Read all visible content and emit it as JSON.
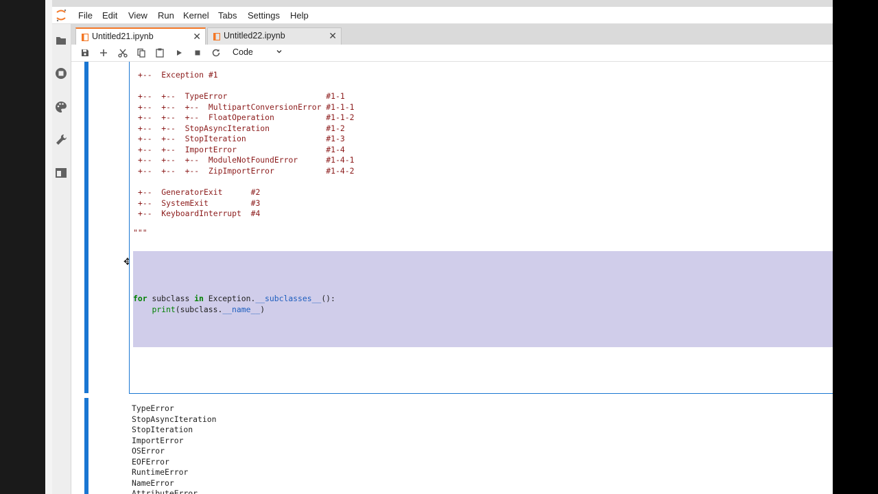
{
  "menu": [
    "File",
    "Edit",
    "View",
    "Run",
    "Kernel",
    "Tabs",
    "Settings",
    "Help"
  ],
  "tabs": [
    {
      "label": "Untitled21.ipynb",
      "active": true
    },
    {
      "label": "Untitled22.ipynb",
      "active": false
    }
  ],
  "toolbar": {
    "cell_type": "Code",
    "buttons": [
      "save-icon",
      "add-cell-icon",
      "cut-icon",
      "copy-icon",
      "paste-icon",
      "run-icon",
      "stop-icon",
      "restart-icon"
    ]
  },
  "sidebar_icons": [
    "folder-icon",
    "running-icon",
    "palette-icon",
    "wrench-icon",
    "tabs-icon"
  ],
  "code": {
    "tree_header": "+--  Exception #1",
    "tree_block1": [
      "+--  +--  TypeError                     #1-1",
      "+--  +--  +--  MultipartConversionError #1-1-1",
      "+--  +--  +--  FloatOperation           #1-1-2",
      "+--  +--  StopAsyncIteration            #1-2",
      "+--  +--  StopIteration                 #1-3",
      "+--  +--  ImportError                   #1-4",
      "+--  +--  +--  ModuleNotFoundError      #1-4-1",
      "+--  +--  +--  ZipImportError           #1-4-2"
    ],
    "tree_block2": [
      "+--  GeneratorExit      #2",
      "+--  SystemExit         #3",
      "+--  KeyboardInterrupt  #4"
    ],
    "docstring_end": "\"\"\"",
    "loop": {
      "kw_for": "for",
      "var": " subclass ",
      "kw_in": "in",
      "obj": " Exception.",
      "dunder": "__subclasses__",
      "tail": "():",
      "indent": "    ",
      "print": "print",
      "arg_start": "(subclass.",
      "name_dunder": "__name__",
      "arg_end": ")"
    }
  },
  "output": [
    "TypeError",
    "StopAsyncIteration",
    "StopIteration",
    "ImportError",
    "OSError",
    "EOFError",
    "RuntimeError",
    "NameError",
    "AttributeError"
  ],
  "colors": {
    "accent": "#1976d2",
    "tab_active_border": "#f37726",
    "selection": "#d0cdea",
    "string": "#8b1a1a",
    "keyword": "#008000"
  }
}
